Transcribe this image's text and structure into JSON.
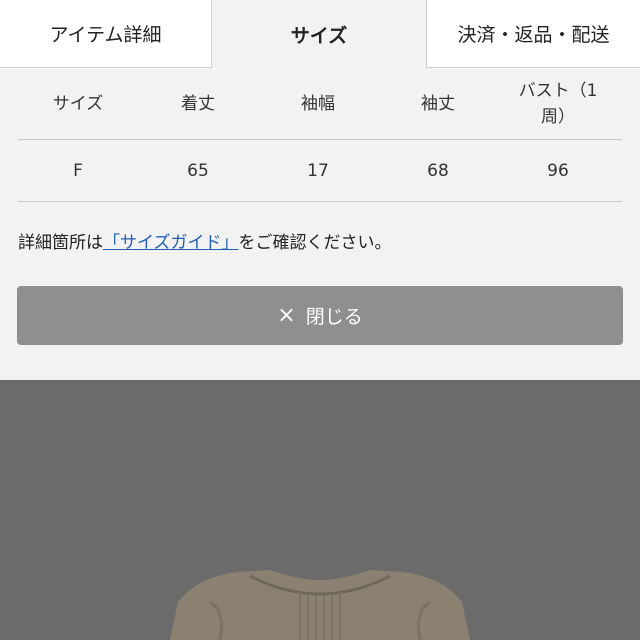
{
  "tabs": [
    {
      "label": "アイテム詳細"
    },
    {
      "label": "サイズ"
    },
    {
      "label": "決済・返品・配送"
    }
  ],
  "size_table": {
    "headers": [
      "サイズ",
      "着丈",
      "袖幅",
      "袖丈",
      "バスト（1周）"
    ],
    "rows": [
      [
        "F",
        "65",
        "17",
        "68",
        "96"
      ]
    ]
  },
  "note": {
    "prefix": "詳細箇所は",
    "link": "「サイズガイド」",
    "suffix": "をご確認ください。"
  },
  "close_button": {
    "icon": "close-icon",
    "label": "閉じる"
  },
  "colors": {
    "link": "#1f5fb8",
    "close_button_bg": "#8f8f8f",
    "overlay": "#6b6b6b",
    "garment": "#8a8170"
  }
}
